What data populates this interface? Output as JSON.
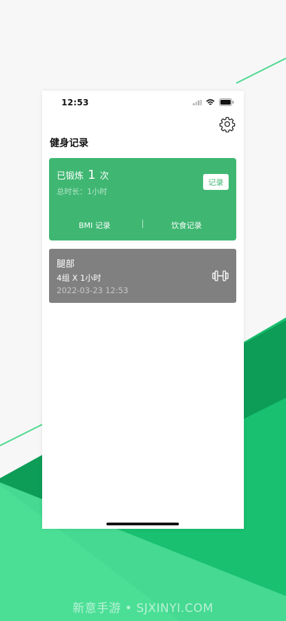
{
  "status_bar": {
    "time": "12:53"
  },
  "header": {
    "title": "健身记录",
    "settings_icon": "gear-icon"
  },
  "summary": {
    "trained_prefix": "已锻炼",
    "trained_count": "1",
    "trained_suffix": "次",
    "duration": "总时长：1小时",
    "record_button": "记录",
    "bmi_link": "BMI 记录",
    "diet_link": "饮食记录"
  },
  "workouts": [
    {
      "name": "腿部",
      "sets": "4组 X 1小时",
      "datetime": "2022-03-23 12:53",
      "icon": "dumbbell-icon"
    }
  ],
  "watermark": "新意手游 • SJXINYI.COM",
  "colors": {
    "accent_green": "#3fb772",
    "workout_card_gray": "#808080",
    "background_green_light": "#47dc91",
    "background_green_dark": "#0fa05a"
  }
}
